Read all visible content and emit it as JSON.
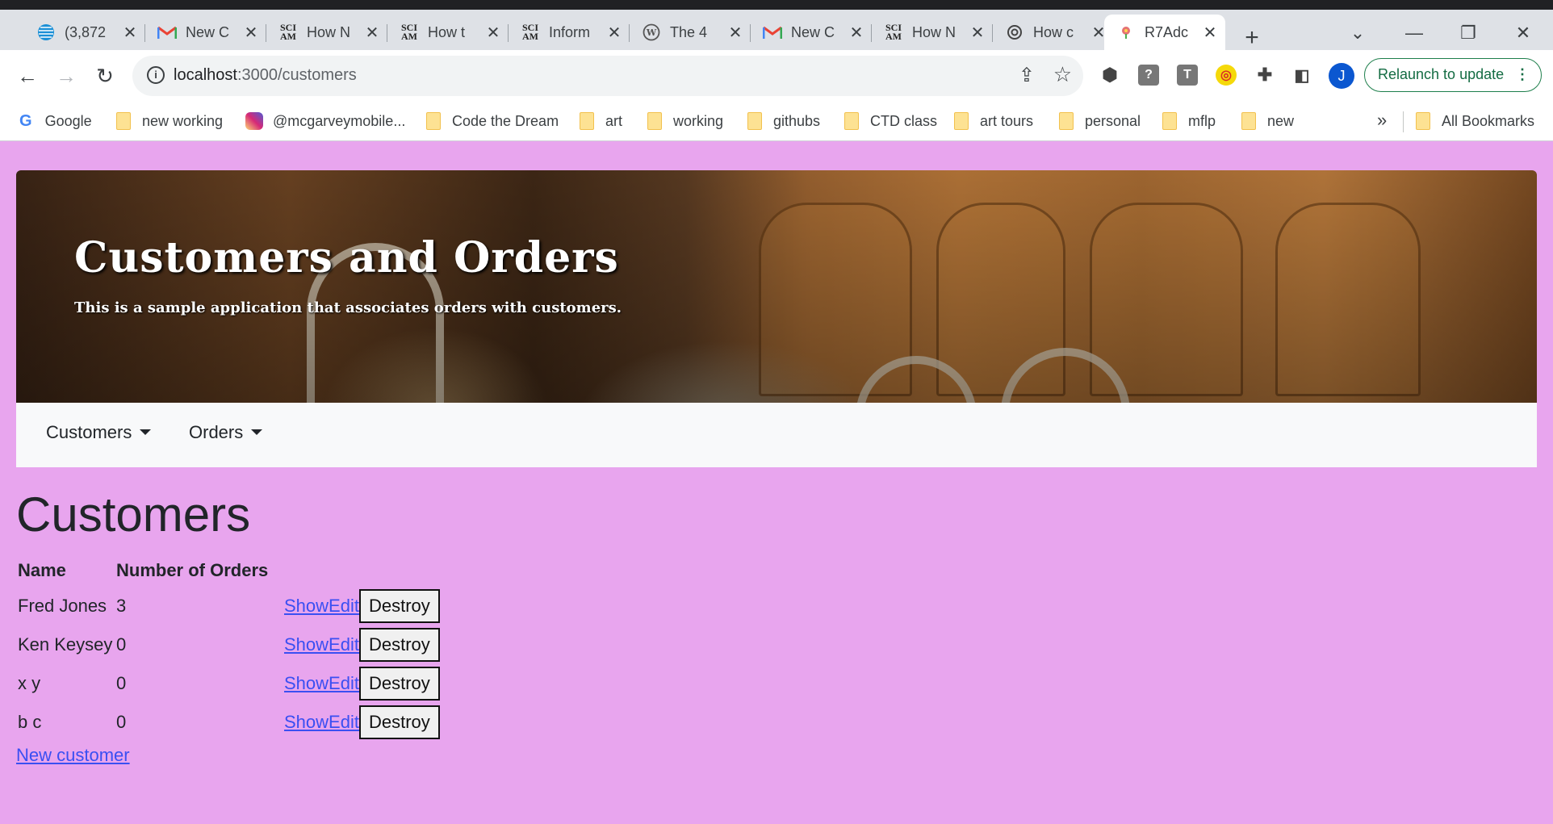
{
  "browser": {
    "tabs": [
      {
        "title": "(3,872",
        "icon": "att-icon"
      },
      {
        "title": "New C",
        "icon": "gmail-icon"
      },
      {
        "title": "How N",
        "icon": "sciam-icon"
      },
      {
        "title": "How t",
        "icon": "sciam-icon"
      },
      {
        "title": "Inform",
        "icon": "sciam-icon"
      },
      {
        "title": "The 4",
        "icon": "wordpress-icon"
      },
      {
        "title": "New C",
        "icon": "gmail-icon"
      },
      {
        "title": "How N",
        "icon": "sciam-icon"
      },
      {
        "title": "How c",
        "icon": "openai-icon"
      },
      {
        "title": "R7Adc",
        "icon": "app-favicon"
      }
    ],
    "sciam_label": "SCI AM",
    "url_host": "localhost",
    "url_path": ":3000/customers",
    "relaunch_label": "Relaunch to update",
    "avatar_letter": "J",
    "bookmarks": [
      "Google",
      "new working",
      "@mcgarveymobile...",
      "Code the Dream",
      "art",
      "working",
      "githubs",
      "CTD class",
      "art tours",
      "personal",
      "mflp",
      "new"
    ],
    "all_bookmarks": "All Bookmarks"
  },
  "header": {
    "title": "Customers and Orders",
    "subtitle": "This is a sample application that associates orders with customers."
  },
  "nav": {
    "customers": "Customers",
    "orders": "Orders"
  },
  "page": {
    "heading": "Customers",
    "columns": [
      "Name",
      "Number of Orders"
    ],
    "rows": [
      {
        "name": "Fred Jones",
        "orders": "3"
      },
      {
        "name": "Ken Keysey",
        "orders": "0"
      },
      {
        "name": "x y",
        "orders": "0"
      },
      {
        "name": "b c",
        "orders": "0"
      }
    ],
    "show_label": "Show",
    "edit_label": "Edit",
    "destroy_label": "Destroy",
    "new_customer": "New customer"
  },
  "colors": {
    "page_background": "#e8a5ee",
    "link": "#3a4ff2",
    "navbar": "#f8f9fa"
  }
}
